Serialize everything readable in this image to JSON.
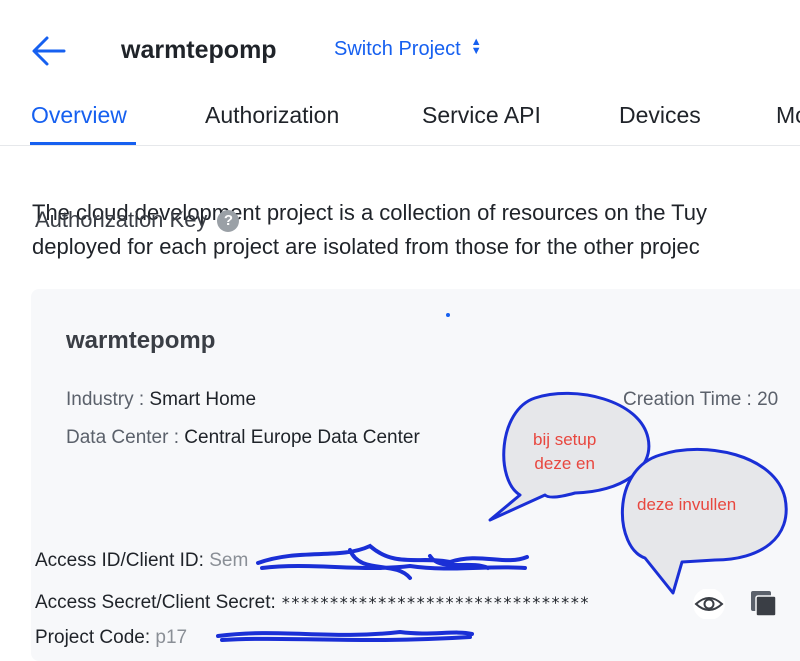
{
  "header": {
    "back_icon": "arrow-left-icon",
    "project_name": "warmtepomp",
    "switch_label": "Switch Project",
    "switch_icon": "sort-updown-icon"
  },
  "tabs": [
    {
      "label": "Overview",
      "active": true
    },
    {
      "label": "Authorization",
      "active": false
    },
    {
      "label": "Service API",
      "active": false
    },
    {
      "label": "Devices",
      "active": false
    },
    {
      "label": "Mo",
      "active": false
    }
  ],
  "description": {
    "line1": "The cloud development project is a collection of resources on the Tuy",
    "line2": "deployed for each project are isolated from those for the other projec"
  },
  "card": {
    "title": "warmtepomp",
    "industry_label": "Industry : ",
    "industry_value": "Smart Home",
    "creation_label": "Creation Time : 20",
    "datacenter_label": "Data Center : ",
    "datacenter_value": "Central Europe Data Center",
    "auth_title": "Authorization Key",
    "help_icon": "question-circle-icon",
    "access_id_label": "Access ID/Client ID:",
    "access_id_value": "Sem                       ",
    "access_secret_label": "Access Secret/Client Secret:",
    "access_secret_value": "********************************",
    "project_code_label": "Project Code:",
    "project_code_value": "p17",
    "eye_icon": "eye-icon",
    "copy_icon": "copy-icon"
  },
  "annotations": {
    "bubble1_line1": "bij setup",
    "bubble1_line2": "deze en",
    "bubble2": "deze invullen",
    "accent": "#e8473f",
    "scribble_color": "#1a2fd6"
  },
  "colors": {
    "brand": "#1660f0",
    "card_bg": "#f7f8fa",
    "text": "#1f2329",
    "label": "#5b616b"
  }
}
